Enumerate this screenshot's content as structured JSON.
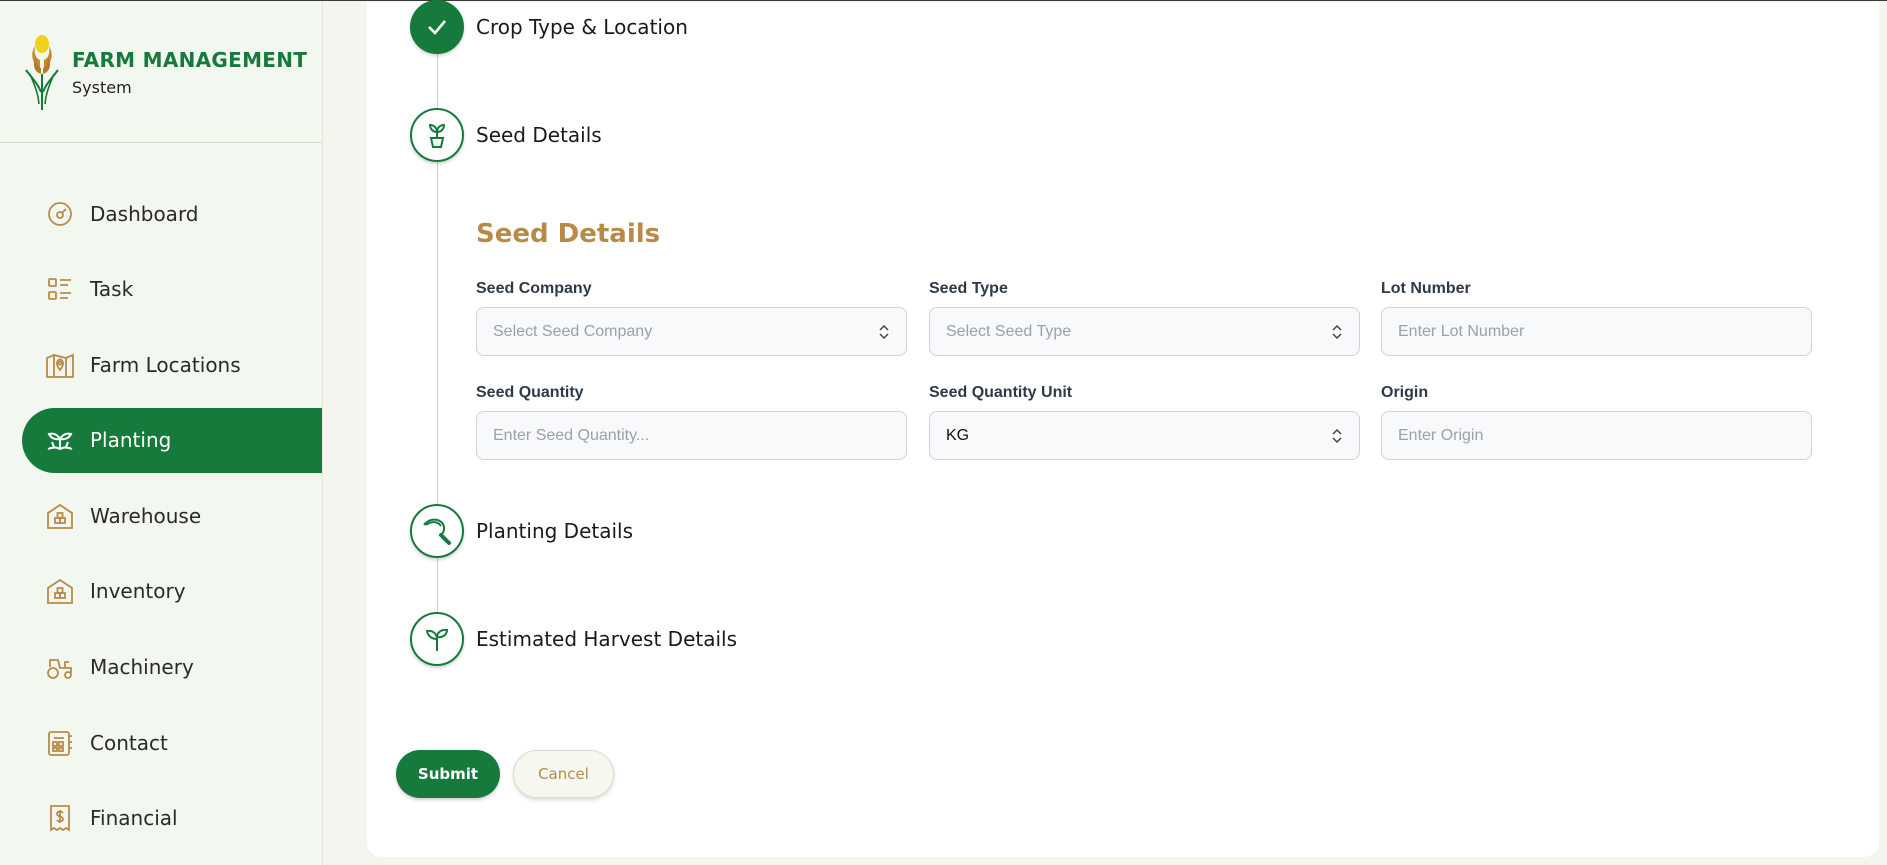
{
  "brand": {
    "title": "FARM MANAGEMENT",
    "subtitle": "System"
  },
  "sidebar": {
    "items": [
      {
        "label": "Dashboard",
        "icon": "gauge-icon"
      },
      {
        "label": "Task",
        "icon": "task-list-icon"
      },
      {
        "label": "Farm Locations",
        "icon": "map-pin-icon"
      },
      {
        "label": "Planting",
        "icon": "sprout-leaves-icon",
        "active": true
      },
      {
        "label": "Warehouse",
        "icon": "warehouse-icon"
      },
      {
        "label": "Inventory",
        "icon": "inventory-icon"
      },
      {
        "label": "Machinery",
        "icon": "tractor-icon"
      },
      {
        "label": "Contact",
        "icon": "contact-book-icon"
      },
      {
        "label": "Financial",
        "icon": "receipt-dollar-icon"
      }
    ]
  },
  "steps": [
    {
      "label": "Crop Type & Location",
      "icon": "check-icon",
      "state": "done"
    },
    {
      "label": "Seed Details",
      "icon": "seedling-pot-icon",
      "state": "current"
    },
    {
      "label": "Planting Details",
      "icon": "sickle-icon",
      "state": "pending"
    },
    {
      "label": "Estimated Harvest Details",
      "icon": "sprout-icon",
      "state": "pending"
    }
  ],
  "form": {
    "section_title": "Seed Details",
    "seed_company": {
      "label": "Seed Company",
      "placeholder": "Select Seed Company"
    },
    "seed_type": {
      "label": "Seed Type",
      "placeholder": "Select Seed Type"
    },
    "lot_number": {
      "label": "Lot Number",
      "placeholder": "Enter Lot Number"
    },
    "seed_quantity": {
      "label": "Seed Quantity",
      "placeholder": "Enter Seed Quantity..."
    },
    "seed_quantity_unit": {
      "label": "Seed Quantity Unit",
      "value": "KG"
    },
    "origin": {
      "label": "Origin",
      "placeholder": "Enter Origin"
    }
  },
  "buttons": {
    "submit": "Submit",
    "cancel": "Cancel"
  },
  "colors": {
    "primary": "#167a3c",
    "accent": "#b88a4a",
    "sidebar_bg": "#f2f8ef"
  }
}
